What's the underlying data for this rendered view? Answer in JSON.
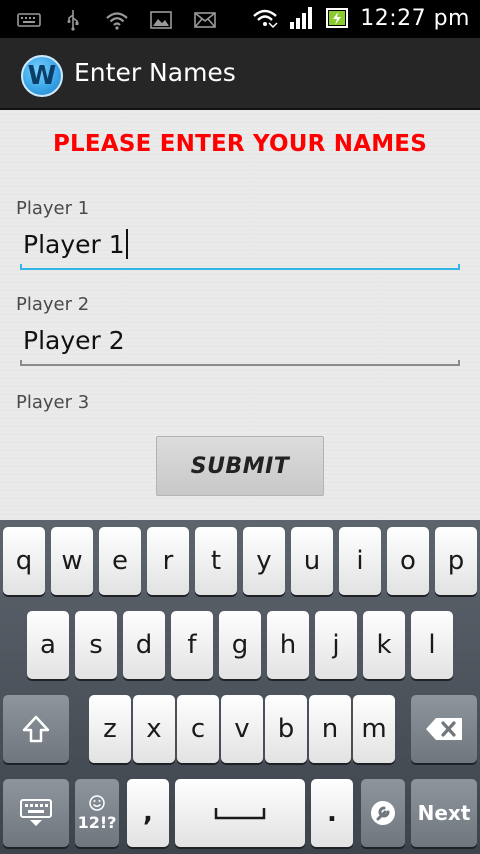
{
  "status_bar": {
    "time": "12:27 pm",
    "left_icons": [
      "keyboard-icon",
      "usb-icon",
      "wifi-icon",
      "image-icon",
      "mail-icon"
    ],
    "right_icons": [
      "wifi-signal-icon",
      "cell-signal-icon",
      "battery-charging-icon"
    ]
  },
  "action_bar": {
    "title": "Enter Names",
    "logo_letter": "W"
  },
  "form": {
    "heading": "PLEASE ENTER YOUR NAMES",
    "heading_color": "#ff0000",
    "players": [
      {
        "label": "Player 1",
        "value": "Player 1"
      },
      {
        "label": "Player 2",
        "value": "Player 2"
      },
      {
        "label": "Player 3"
      }
    ],
    "submit_label": "SUBMIT",
    "focus_color": "#33b5e5"
  },
  "keyboard": {
    "row1": [
      "q",
      "w",
      "e",
      "r",
      "t",
      "y",
      "u",
      "i",
      "o",
      "p"
    ],
    "row2": [
      "a",
      "s",
      "d",
      "f",
      "g",
      "h",
      "j",
      "k",
      "l"
    ],
    "row3": [
      "z",
      "x",
      "c",
      "v",
      "b",
      "n",
      "m"
    ],
    "symbols_label": "12!?",
    "comma_label": ",",
    "period_label": ".",
    "next_label": "Next",
    "icons": [
      "shift-icon",
      "backspace-icon",
      "keyboard-settings-icon",
      "smiley-icon",
      "space-icon",
      "wrench-icon"
    ]
  }
}
